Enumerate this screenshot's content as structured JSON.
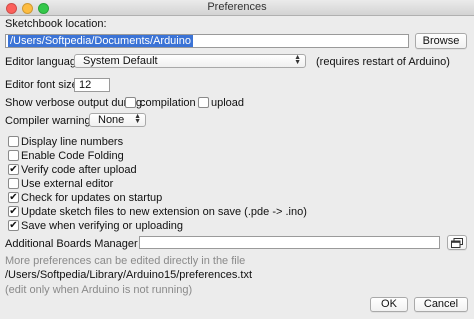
{
  "window": {
    "title": "Preferences"
  },
  "sketchbook": {
    "label": "Sketchbook location:",
    "path": "/Users/Softpedia/Documents/Arduino",
    "browse_label": "Browse"
  },
  "editor_language": {
    "label": "Editor language:",
    "value": "System Default",
    "note": "(requires restart of Arduino)"
  },
  "font_size": {
    "label": "Editor font size:",
    "value": "12"
  },
  "verbose": {
    "label": "Show verbose output during:",
    "options": [
      {
        "label": "compilation",
        "checked": false
      },
      {
        "label": "upload",
        "checked": false
      }
    ]
  },
  "compiler_warnings": {
    "label": "Compiler warnings:",
    "value": "None"
  },
  "options": [
    {
      "label": "Display line numbers",
      "checked": false
    },
    {
      "label": "Enable Code Folding",
      "checked": false
    },
    {
      "label": "Verify code after upload",
      "checked": true
    },
    {
      "label": "Use external editor",
      "checked": false
    },
    {
      "label": "Check for updates on startup",
      "checked": true
    },
    {
      "label": "Update sketch files to new extension on save (.pde -> .ino)",
      "checked": true
    },
    {
      "label": "Save when verifying or uploading",
      "checked": true
    }
  ],
  "boards_manager": {
    "label": "Additional Boards Manager URLs:",
    "value": ""
  },
  "notes": {
    "more_prefs": "More preferences can be edited directly in the file",
    "prefs_path": "/Users/Softpedia/Library/Arduino15/preferences.txt",
    "edit_note": "(edit only when Arduino is not running)"
  },
  "buttons": {
    "ok": "OK",
    "cancel": "Cancel"
  },
  "check_glyph": "✔"
}
